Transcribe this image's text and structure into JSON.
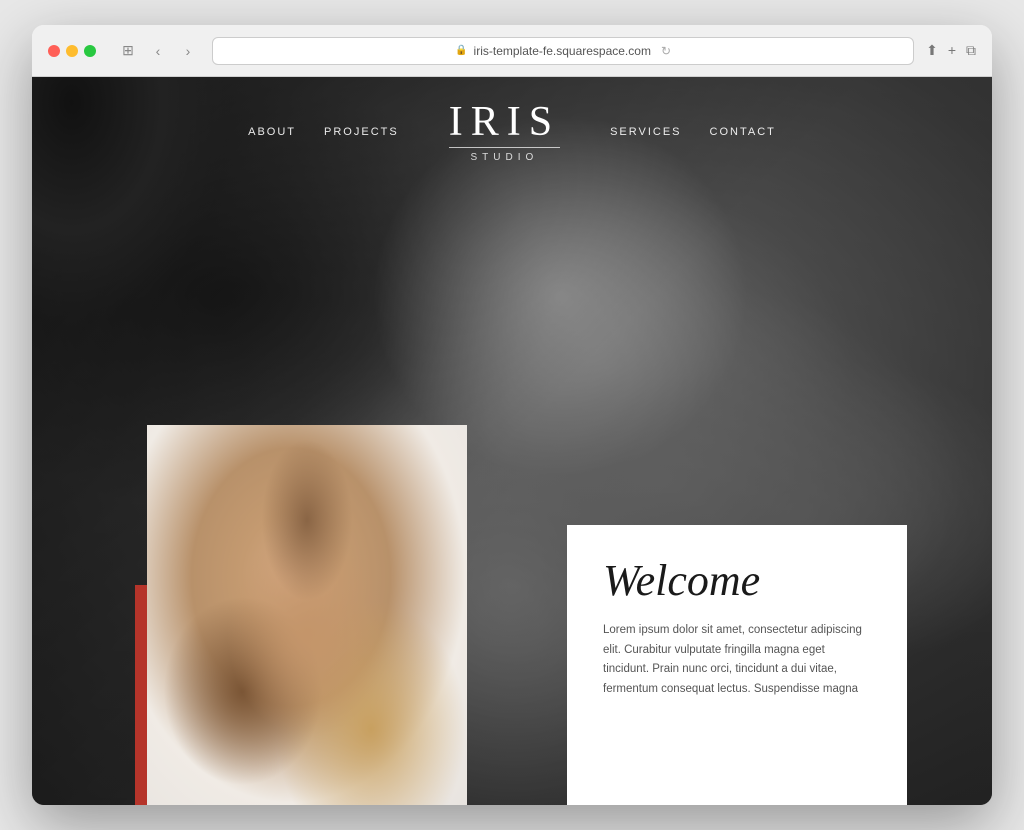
{
  "browser": {
    "url": "iris-template-fe.squarespace.com",
    "traffic_lights": [
      "red",
      "yellow",
      "green"
    ]
  },
  "nav": {
    "left": [
      {
        "label": "About",
        "id": "about"
      },
      {
        "label": "Projects",
        "id": "projects"
      }
    ],
    "right": [
      {
        "label": "Services",
        "id": "services"
      },
      {
        "label": "Contact",
        "id": "contact"
      }
    ]
  },
  "logo": {
    "main": "IRIS",
    "sub": "STUDIO"
  },
  "hero": {
    "welcome_heading": "Welcome",
    "welcome_text": "Lorem ipsum dolor sit amet, consectetur adipiscing elit. Curabitur vulputate fringilla magna eget tincidunt. Prain nunc orci, tincidunt a dui vitae, fermentum consequat lectus. Suspendisse magna"
  }
}
